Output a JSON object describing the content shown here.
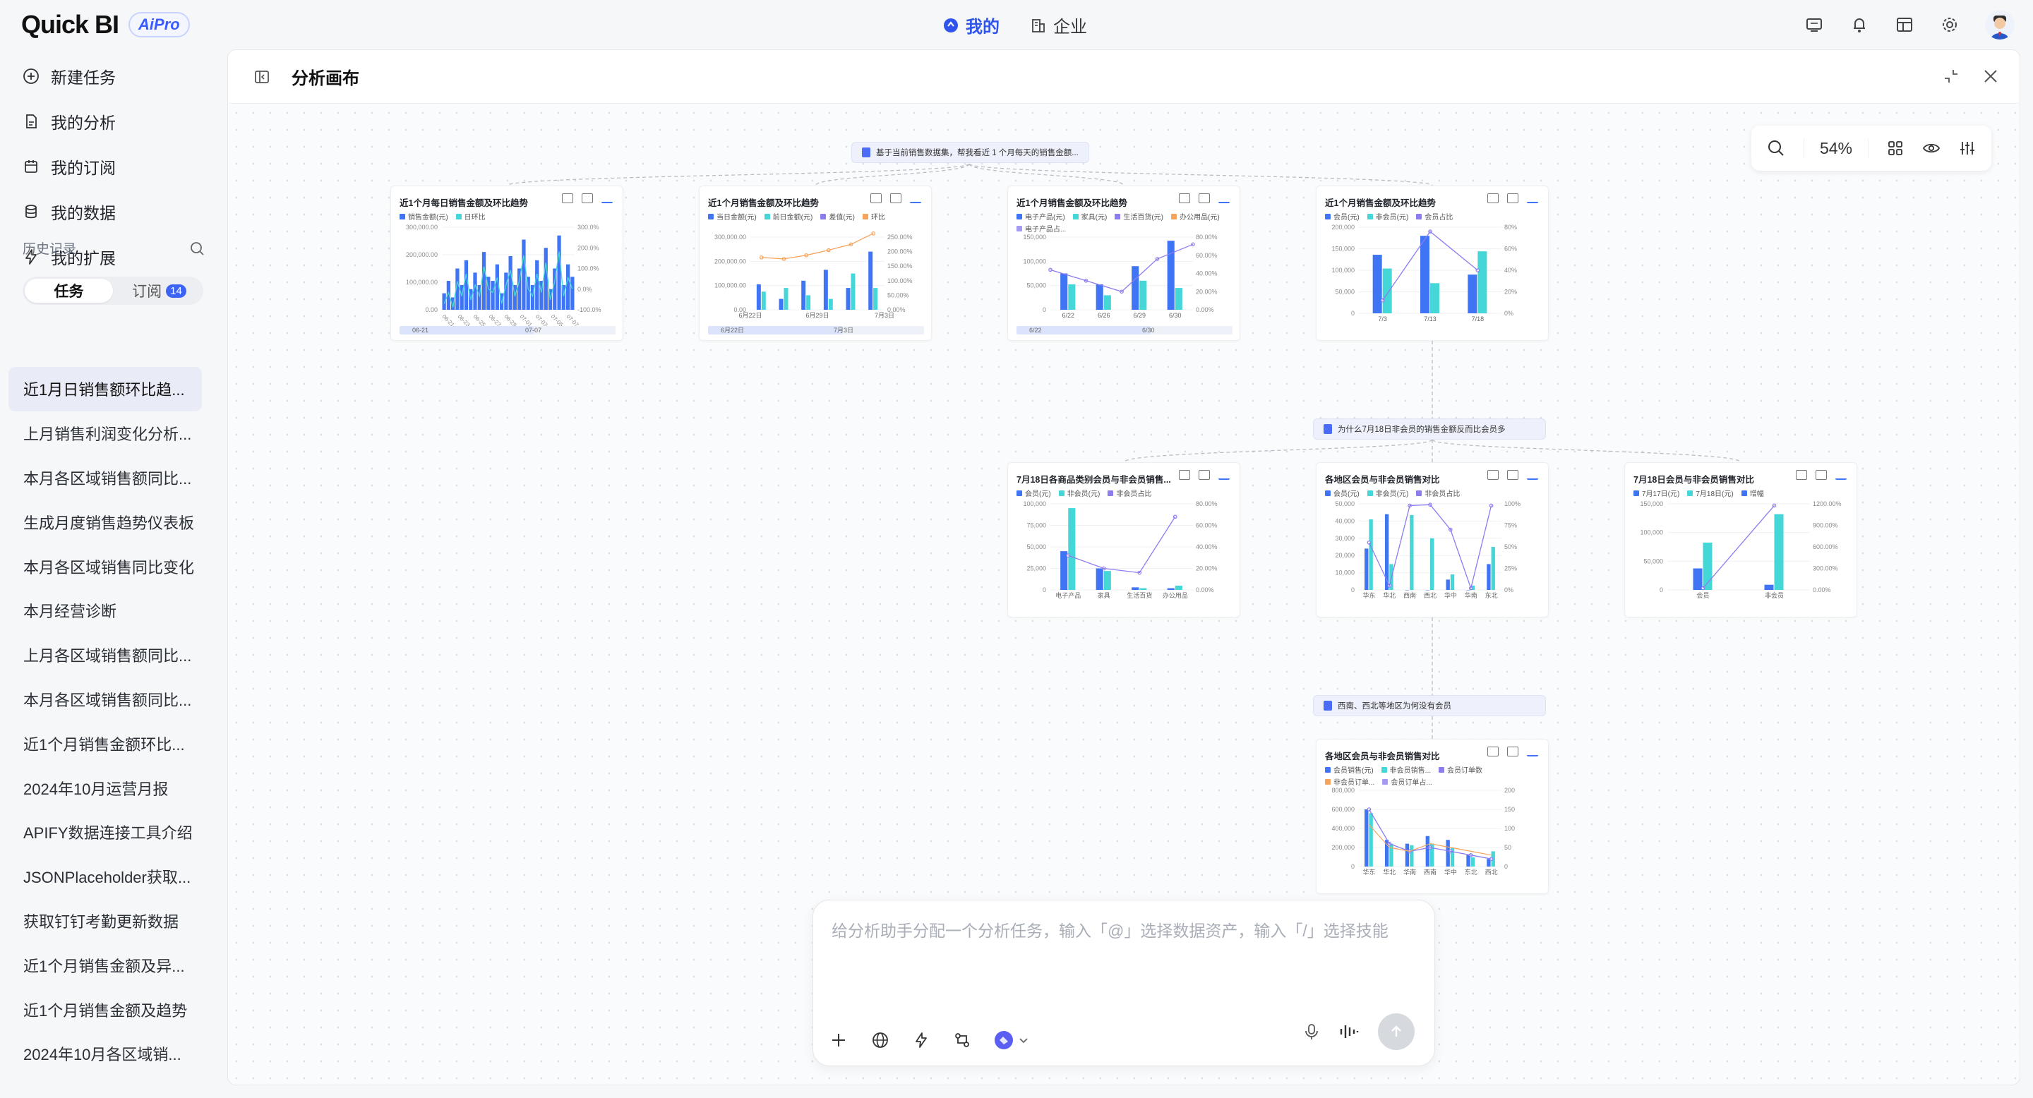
{
  "app": {
    "logo": "Quick BI",
    "badge": "AiPro"
  },
  "topnav": {
    "mine": "我的",
    "enterprise": "企业"
  },
  "sidebar": {
    "items": [
      {
        "label": "新建任务",
        "icon": "plus-circle-icon"
      },
      {
        "label": "我的分析",
        "icon": "document-icon"
      },
      {
        "label": "我的订阅",
        "icon": "calendar-icon"
      },
      {
        "label": "我的数据",
        "icon": "database-icon"
      },
      {
        "label": "我的扩展",
        "icon": "lightning-icon"
      }
    ],
    "history_title": "历史记录",
    "tabs": {
      "tasks": "任务",
      "subs": "订阅",
      "subs_count": "14"
    },
    "history": [
      "近1月日销售额环比趋...",
      "上月销售利润变化分析...",
      "本月各区域销售额同比...",
      "生成月度销售趋势仪表板",
      "本月各区域销售同比变化",
      "本月经营诊断",
      "上月各区域销售额同比...",
      "本月各区域销售额同比...",
      "近1个月销售金额环比...",
      "2024年10月运营月报",
      "APIFY数据连接工具介绍",
      "JSONPlaceholder获取...",
      "获取钉钉考勤更新数据",
      "近1个月销售金额及异...",
      "近1个月销售金额及趋势",
      "2024年10月各区域销..."
    ]
  },
  "panel": {
    "title": "分析画布",
    "zoom": "54%"
  },
  "canvas": {
    "q1": "基于当前销售数据集，帮我看近 1 个月每天的销售金额...",
    "q2": "为什么7月18日非会员的销售金额反而比会员多",
    "q3": "西南、西北等地区为何没有会员",
    "cards": [
      {
        "title": "近1个月每日销售金额及环比趋势",
        "legend": [
          "销售金额(元)",
          "日环比"
        ],
        "ticks": [
          "300,000.00",
          "200,000.00",
          "100,000.00",
          "0.00"
        ],
        "rticks": [
          "300.0%",
          "200.0%",
          "100.0%",
          "0.0%",
          "-100.0%"
        ],
        "range": [
          "06-21",
          "07-07"
        ]
      },
      {
        "title": "近1个月销售金额及环比趋势",
        "legend": [
          "当日金额(元)",
          "前日金额(元)",
          "差值(元)",
          "环比"
        ],
        "ticks": [
          "300,000.00",
          "200,000.00",
          "100,000.00",
          "0.00"
        ],
        "rticks": [
          "250.00%",
          "200.00%",
          "150.00%",
          "100.00%",
          "50.00%",
          "0.00%"
        ],
        "xlabels": [
          "6月22日",
          "6月29日",
          "7月3日"
        ],
        "range": [
          "6月22日",
          "7月3日"
        ]
      },
      {
        "title": "近1个月销售金额及环比趋势",
        "legend": [
          "电子产品(元)",
          "家具(元)",
          "生活百货(元)",
          "办公用品(元)",
          "电子产品占..."
        ],
        "ticks": [
          "150,000",
          "100,000",
          "50,000",
          "0"
        ],
        "rticks": [
          "80.00%",
          "60.00%",
          "40.00%",
          "20.00%",
          "0.00%"
        ],
        "xlabels": [
          "6/22",
          "6/26",
          "6/29",
          "6/30"
        ],
        "range": [
          "6/22",
          "6/30"
        ]
      },
      {
        "title": "近1个月销售金额及环比趋势",
        "legend": [
          "会员(元)",
          "非会员(元)",
          "会员占比"
        ],
        "ticks": [
          "200,000",
          "150,000",
          "100,000",
          "50,000",
          "0"
        ],
        "rticks": [
          "80%",
          "60%",
          "40%",
          "20%",
          "0%"
        ],
        "xlabels": [
          "7/3",
          "7/13",
          "7/18"
        ]
      },
      {
        "title": "7月18日各商品类别会员与非会员销售...",
        "legend": [
          "会员(元)",
          "非会员(元)",
          "非会员占比"
        ],
        "ticks": [
          "100,000",
          "75,000",
          "50,000",
          "25,000",
          "0"
        ],
        "rticks": [
          "80.00%",
          "60.00%",
          "40.00%",
          "20.00%",
          "0.00%"
        ],
        "xlabels": [
          "电子产品",
          "家具",
          "生活百货",
          "办公用品"
        ]
      },
      {
        "title": "各地区会员与非会员销售对比",
        "legend": [
          "会员(元)",
          "非会员(元)",
          "非会员占比"
        ],
        "ticks": [
          "50,000",
          "40,000",
          "30,000",
          "20,000",
          "10,000",
          "0"
        ],
        "rticks": [
          "100%",
          "75%",
          "50%",
          "25%",
          "0%"
        ],
        "xlabels": [
          "华东",
          "华北",
          "西南",
          "西北",
          "华中",
          "华南",
          "东北"
        ]
      },
      {
        "title": "7月18日会员与非会员销售对比",
        "legend": [
          "7月17日(元)",
          "7月18日(元)",
          "增幅"
        ],
        "ticks": [
          "150,000",
          "100,000",
          "50,000",
          "0"
        ],
        "rticks": [
          "1200.00%",
          "900.00%",
          "600.00%",
          "300.00%",
          "0.00%"
        ],
        "xlabels": [
          "会员",
          "非会员"
        ]
      },
      {
        "title": "各地区会员与非会员销售对比",
        "legend": [
          "会员销售(元)",
          "非会员销售...",
          "会员订单数",
          "非会员订单...",
          "会员订单占..."
        ],
        "ticks": [
          "800,000",
          "600,000",
          "400,000",
          "200,000",
          "0"
        ],
        "rticks": [
          "200",
          "150",
          "100",
          "50",
          "0"
        ],
        "xlabels": [
          "华东",
          "华北",
          "华南",
          "西南",
          "华中",
          "东北",
          "西北"
        ]
      }
    ]
  },
  "composer": {
    "placeholder": "给分析助手分配一个分析任务，输入「@」选择数据资产，输入「/」选择技能"
  },
  "colors": {
    "blue": "#3f74f5",
    "cyan": "#45d6d8",
    "purple": "#8b7cf0",
    "orange": "#f6a35b",
    "accent": "#2f54eb"
  }
}
